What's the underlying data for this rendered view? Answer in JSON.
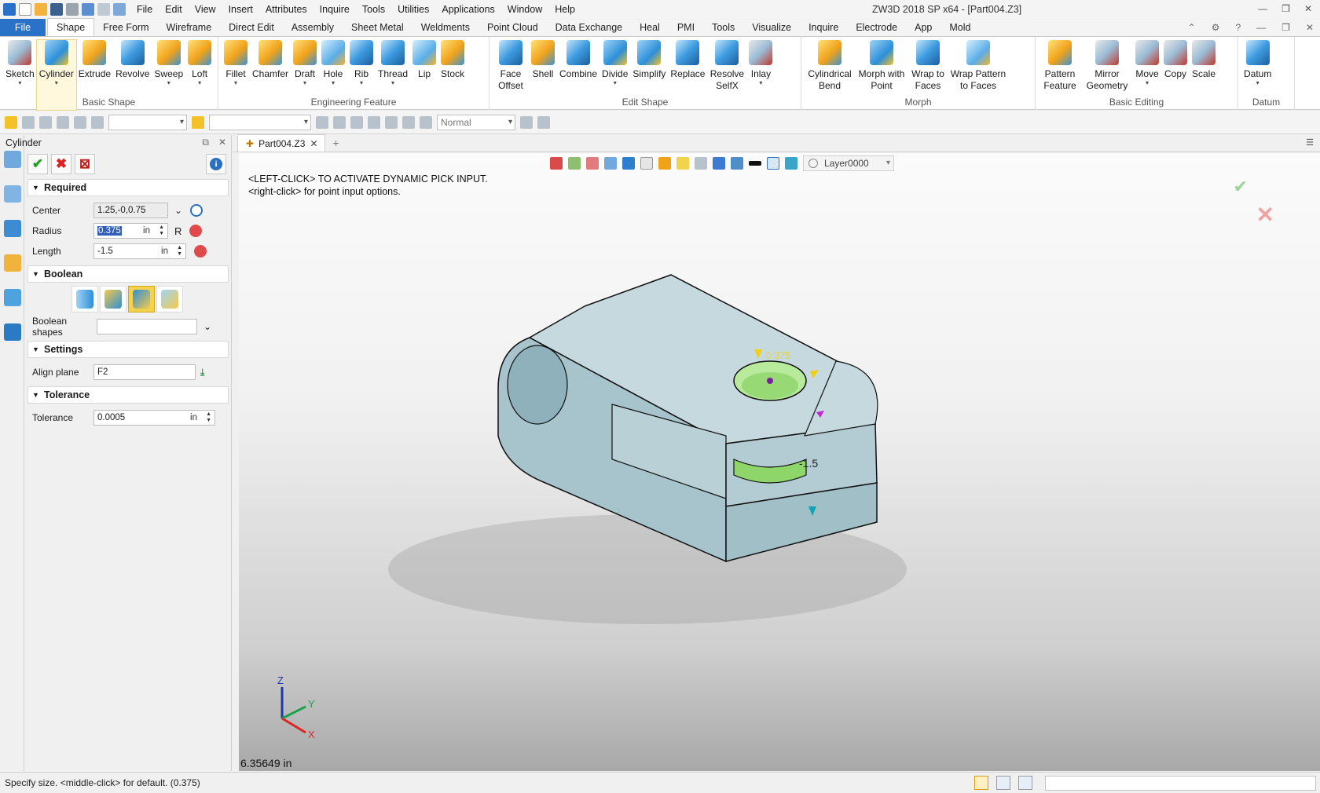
{
  "app": {
    "window_title": "ZW3D 2018 SP x64 - [Part004.Z3]",
    "menu": [
      "File",
      "Edit",
      "View",
      "Insert",
      "Attributes",
      "Inquire",
      "Tools",
      "Utilities",
      "Applications",
      "Window",
      "Help"
    ]
  },
  "ribbon": {
    "tabs": [
      "File",
      "Shape",
      "Free Form",
      "Wireframe",
      "Direct Edit",
      "Assembly",
      "Sheet Metal",
      "Weldments",
      "Point Cloud",
      "Data Exchange",
      "Heal",
      "PMI",
      "Tools",
      "Visualize",
      "Inquire",
      "Electrode",
      "App",
      "Mold"
    ],
    "active_tab": "Shape",
    "groups": [
      {
        "name": "Basic Shape",
        "buttons": [
          {
            "label": "Sketch",
            "icon": "sketch-icon"
          },
          {
            "label": "Cylinder",
            "icon": "cylinder-icon"
          },
          {
            "label": "Extrude",
            "icon": "extrude-icon"
          },
          {
            "label": "Revolve",
            "icon": "revolve-icon"
          },
          {
            "label": "Sweep",
            "icon": "sweep-icon"
          },
          {
            "label": "Loft",
            "icon": "loft-icon"
          }
        ]
      },
      {
        "name": "Engineering Feature",
        "buttons": [
          {
            "label": "Fillet",
            "icon": "fillet-icon"
          },
          {
            "label": "Chamfer",
            "icon": "chamfer-icon"
          },
          {
            "label": "Draft",
            "icon": "draft-icon"
          },
          {
            "label": "Hole",
            "icon": "hole-icon"
          },
          {
            "label": "Rib",
            "icon": "rib-icon"
          },
          {
            "label": "Thread",
            "icon": "thread-icon"
          },
          {
            "label": "Lip",
            "icon": "lip-icon"
          },
          {
            "label": "Stock",
            "icon": "stock-icon"
          }
        ]
      },
      {
        "name": "Edit Shape",
        "buttons": [
          {
            "label": "Face Offset",
            "icon": "face-offset-icon"
          },
          {
            "label": "Shell",
            "icon": "shell-icon"
          },
          {
            "label": "Combine",
            "icon": "combine-icon"
          },
          {
            "label": "Divide",
            "icon": "divide-icon"
          },
          {
            "label": "Simplify",
            "icon": "simplify-icon"
          },
          {
            "label": "Replace",
            "icon": "replace-icon"
          },
          {
            "label": "Resolve SelfX",
            "icon": "resolve-selfx-icon"
          },
          {
            "label": "Inlay",
            "icon": "inlay-icon"
          }
        ]
      },
      {
        "name": "Morph",
        "buttons": [
          {
            "label": "Cylindrical Bend",
            "icon": "cylindrical-bend-icon"
          },
          {
            "label": "Morph with Point",
            "icon": "morph-point-icon"
          },
          {
            "label": "Wrap to Faces",
            "icon": "wrap-faces-icon"
          },
          {
            "label": "Wrap Pattern to Faces",
            "icon": "wrap-pattern-icon"
          }
        ]
      },
      {
        "name": "Basic Editing",
        "buttons": [
          {
            "label": "Pattern Feature",
            "icon": "pattern-icon"
          },
          {
            "label": "Mirror Geometry",
            "icon": "mirror-icon"
          },
          {
            "label": "Move",
            "icon": "move-icon"
          },
          {
            "label": "Copy",
            "icon": "copy-icon"
          },
          {
            "label": "Scale",
            "icon": "scale-icon"
          }
        ]
      },
      {
        "name": "Datum",
        "buttons": [
          {
            "label": "Datum",
            "icon": "datum-icon"
          }
        ]
      }
    ]
  },
  "toolbar": {
    "render_mode": "Normal"
  },
  "panel": {
    "title": "Cylinder",
    "sections": {
      "required": "Required",
      "boolean": "Boolean",
      "settings": "Settings",
      "tolerance": "Tolerance"
    },
    "center": {
      "label": "Center",
      "value": "1.25,-0,0.75"
    },
    "radius": {
      "label": "Radius",
      "value": "0.375",
      "unit": "in",
      "suffix": "R"
    },
    "length": {
      "label": "Length",
      "value": "-1.5",
      "unit": "in"
    },
    "boolean_shapes": {
      "label": "Boolean shapes",
      "value": ""
    },
    "align_plane": {
      "label": "Align plane",
      "value": "F2"
    },
    "tolerance": {
      "label": "Tolerance",
      "value": "0.0005",
      "unit": "in"
    }
  },
  "document": {
    "tab": "Part004.Z3",
    "layer": "Layer0000",
    "prompt_line1": "<LEFT-CLICK> TO ACTIVATE DYNAMIC PICK INPUT.",
    "prompt_line2": "<right-click> for point input options.",
    "dim_radius": "0.375",
    "dim_length": "-1.5",
    "axis": {
      "x": "X",
      "y": "Y",
      "z": "Z"
    },
    "measurement": "6.35649 in"
  },
  "status": {
    "message": "Specify size.   <middle-click> for default. (0.375)"
  }
}
